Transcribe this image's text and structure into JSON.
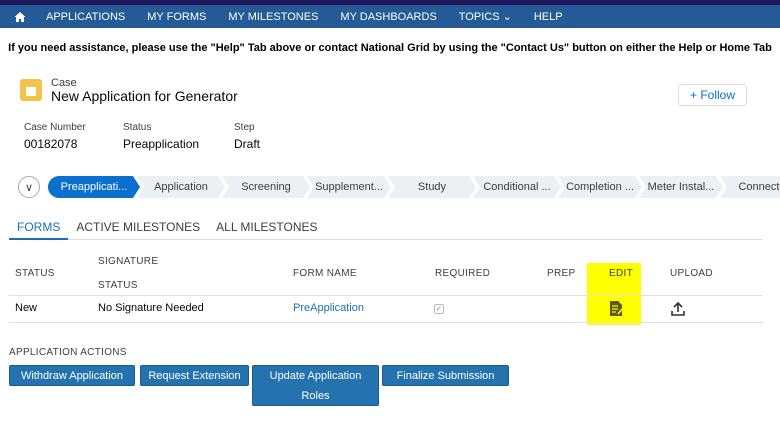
{
  "nav": {
    "items": [
      "APPLICATIONS",
      "MY FORMS",
      "MY MILESTONES",
      "MY DASHBOARDS",
      "TOPICS",
      "HELP"
    ],
    "home_icon": "home-icon"
  },
  "assist_text": "If you need assistance,  please use the \"Help\" Tab above or contact National Grid by using the \"Contact Us\" button  on  either the  Help or Home Tab",
  "record": {
    "object_label": "Case",
    "title": "New Application for Generator",
    "follow_label": "+ Follow",
    "fields": [
      {
        "label": "Case Number",
        "value": "00182078"
      },
      {
        "label": "Status",
        "value": "Preapplication"
      },
      {
        "label": "Step",
        "value": "Draft"
      }
    ]
  },
  "path": {
    "stages": [
      "Preapplicati...",
      "Application",
      "Screening",
      "Supplement...",
      "Study",
      "Conditional ...",
      "Completion ...",
      "Meter Instal...",
      "Connecte"
    ],
    "active_index": 0
  },
  "tabs": [
    "FORMS",
    "ACTIVE MILESTONES",
    "ALL MILESTONES"
  ],
  "table": {
    "headers": {
      "status": "STATUS",
      "signature1": "SIGNATURE",
      "signature2": "STATUS",
      "form_name": "FORM NAME",
      "required": "REQUIRED",
      "prep": "PREP",
      "edit": "EDIT",
      "upload": "UPLOAD"
    },
    "rows": [
      {
        "status": "New",
        "signature_status": "No Signature Needed",
        "form_name": "PreApplication",
        "required": true,
        "check": "✓"
      }
    ]
  },
  "actions": {
    "label": "APPLICATION ACTIONS",
    "buttons": [
      "Withdraw Application",
      "Request Extension",
      "Update Application Roles",
      "Finalize Submission"
    ]
  },
  "colors": {
    "nav": "#245a95",
    "accent": "#0a6fcf",
    "highlight": "#ffff00",
    "button": "#2573ae"
  }
}
